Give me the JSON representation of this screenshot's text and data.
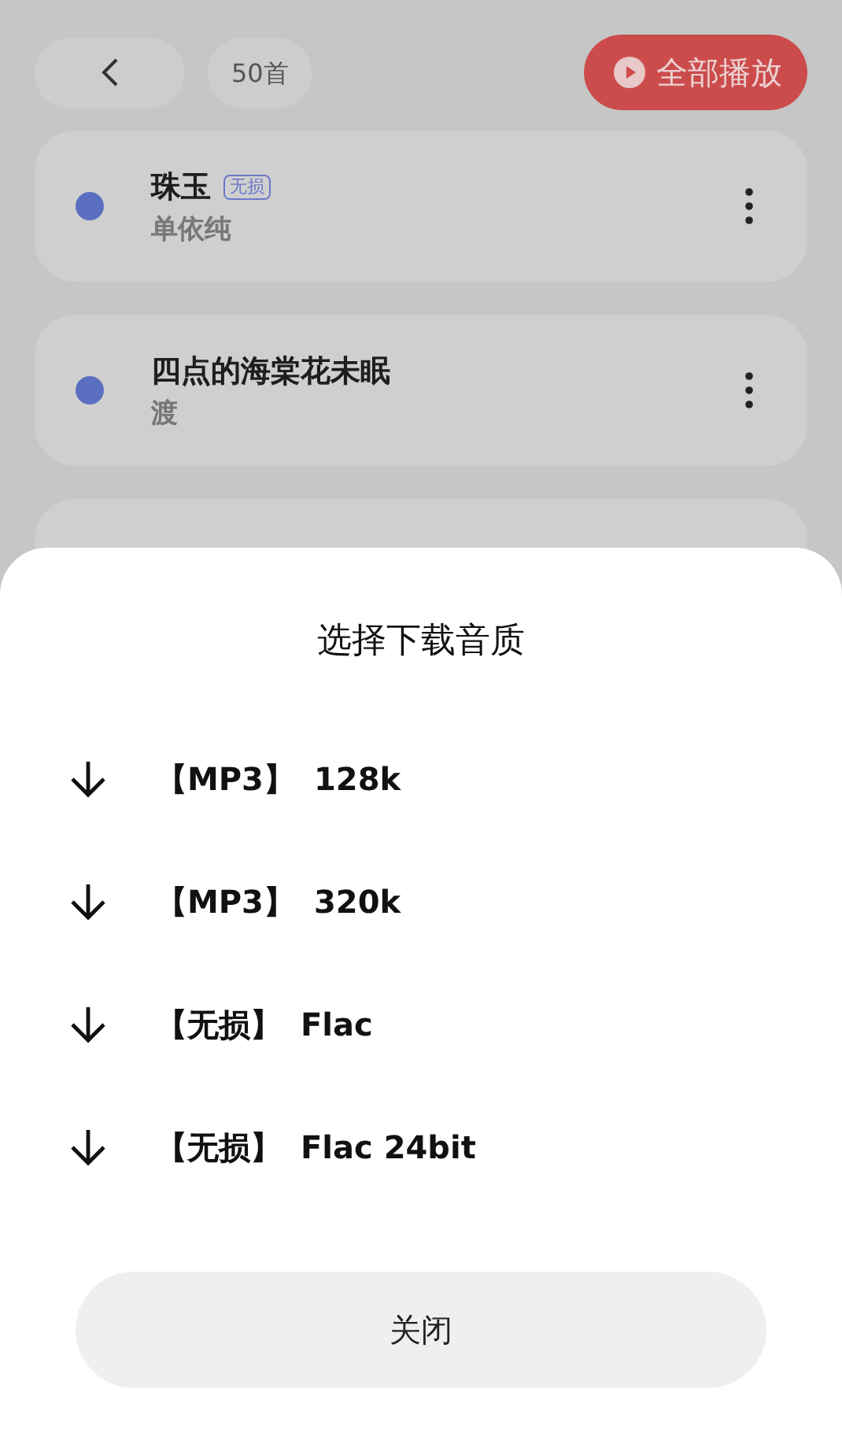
{
  "header": {
    "count": "50首",
    "play_all": "全部播放"
  },
  "songs": [
    {
      "title": "珠玉",
      "badge": "无损",
      "artist": "单依纯"
    },
    {
      "title": "四点的海棠花未眠",
      "artist": "渡"
    }
  ],
  "next_card_peek": true,
  "sheet": {
    "title": "选择下载音质",
    "options": [
      {
        "format": "【MP3】",
        "quality": "128k"
      },
      {
        "format": "【MP3】",
        "quality": "320k"
      },
      {
        "format": "【无损】",
        "quality": "Flac"
      },
      {
        "format": "【无损】",
        "quality": "Flac 24bit"
      }
    ],
    "close": "关闭"
  }
}
